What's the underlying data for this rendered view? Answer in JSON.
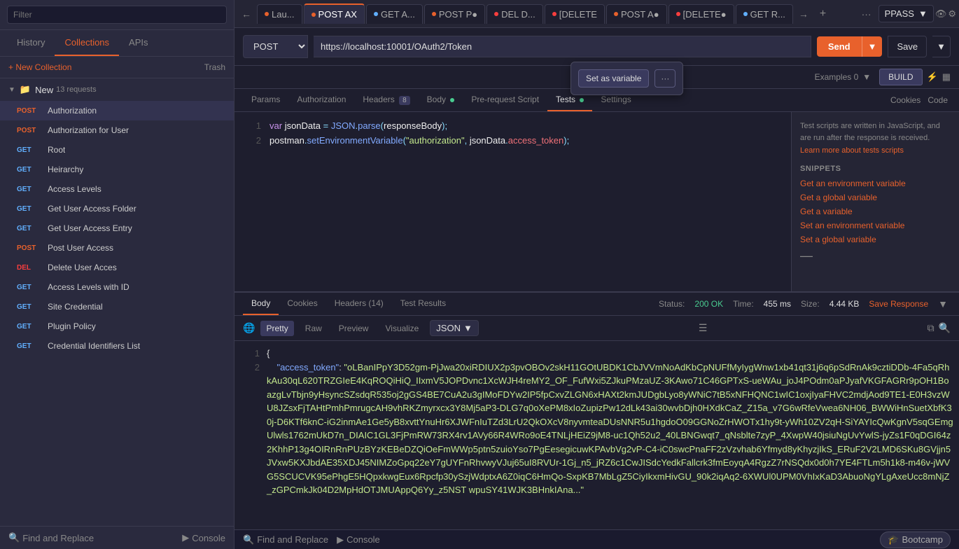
{
  "sidebar": {
    "search_placeholder": "Filter",
    "tabs": [
      "History",
      "Collections",
      "APIs"
    ],
    "active_tab": "Collections",
    "new_collection_label": "+ New Collection",
    "trash_label": "Trash",
    "collection": {
      "name": "New",
      "count": "13 requests"
    },
    "items": [
      {
        "method": "POST",
        "label": "Authorization",
        "active": true
      },
      {
        "method": "POST",
        "label": "Authorization for User"
      },
      {
        "method": "GET",
        "label": "Root"
      },
      {
        "method": "GET",
        "label": "Heirarchy"
      },
      {
        "method": "GET",
        "label": "Access Levels"
      },
      {
        "method": "GET",
        "label": "Get User Access Folder"
      },
      {
        "method": "GET",
        "label": "Get User Access Entry"
      },
      {
        "method": "POST",
        "label": "Post User Access"
      },
      {
        "method": "DEL",
        "label": "Delete User Acces"
      },
      {
        "method": "GET",
        "label": "Access Levels with ID"
      },
      {
        "method": "GET",
        "label": "Site Credential"
      },
      {
        "method": "GET",
        "label": "Plugin Policy"
      },
      {
        "method": "GET",
        "label": "Credential Identifiers List"
      }
    ],
    "bottom": {
      "find_replace": "Find and Replace",
      "console": "Console"
    }
  },
  "tabs_bar": {
    "tabs": [
      {
        "label": "Lau...",
        "method": "POST",
        "dot_color": "orange"
      },
      {
        "label": "POST AX",
        "method": "POST",
        "dot_color": "orange",
        "active": true
      },
      {
        "label": "GET A...",
        "method": "GET",
        "dot_color": "blue"
      },
      {
        "label": "POST P●",
        "method": "POST",
        "dot_color": "orange"
      },
      {
        "label": "DEL D...",
        "method": "DEL",
        "dot_color": "red"
      },
      {
        "label": "[DELETE",
        "method": "DEL",
        "dot_color": "red"
      },
      {
        "label": "POST A●",
        "method": "POST",
        "dot_color": "orange"
      },
      {
        "label": "[DELETE●",
        "method": "DEL",
        "dot_color": "red"
      },
      {
        "label": "GET R...",
        "method": "GET",
        "dot_color": "blue"
      }
    ]
  },
  "env_bar": {
    "environment": "PPASS"
  },
  "request": {
    "method": "POST",
    "url": "https://localhost:10001/OAuth2/Token",
    "send_label": "Send",
    "save_label": "Save"
  },
  "variable_popup": {
    "button_label": "Set as variable",
    "more_label": "···"
  },
  "request_tabs": {
    "tabs": [
      "Params",
      "Authorization",
      "Headers (8)",
      "Body ●",
      "Pre-request Script",
      "Tests ●",
      "Settings"
    ],
    "active": "Tests ●",
    "cookies_label": "Cookies",
    "code_label": "Code"
  },
  "editor": {
    "lines": [
      {
        "num": 1,
        "code": "var jsonData = JSON.parse(responseBody);"
      },
      {
        "num": 2,
        "code": "postman.setEnvironmentVariable(\"authorization\", jsonData.access_token);"
      }
    ]
  },
  "right_panel": {
    "description": "Test scripts are written in JavaScript, and are run after the response is received.",
    "learn_more": "Learn more about tests scripts",
    "snippets_title": "SNIPPETS",
    "snippets": [
      "Get an environment variable",
      "Get a global variable",
      "Get a variable",
      "Set an environment variable",
      "Set a global variable"
    ]
  },
  "response": {
    "tabs": [
      "Body",
      "Cookies",
      "Headers (14)",
      "Test Results"
    ],
    "active_tab": "Body",
    "status": "200 OK",
    "time": "455 ms",
    "size": "4.44 KB",
    "save_response": "Save Response",
    "format_buttons": [
      "Pretty",
      "Raw",
      "Preview",
      "Visualize"
    ],
    "active_format": "Pretty",
    "format_type": "JSON",
    "body_lines": [
      {
        "num": 1,
        "content": "{"
      },
      {
        "num": 2,
        "content": "    \"access_token\": \"oLBanIPpY3D52gm-PjJwa20xiRDIUX2p3pvOBOv2skH11GOtUBDK1CbJVVmNoAdKbCpNUFfMyIygWnw1xb41qt31j6q6pSdRnAk9cztiDDb-4Fa5qRhkAu30qL620TRZGIeE4KqROQiHiQ_IIxmV5JOPDvnc1XcWJH4reMY2_OF_FufWxi5ZJkuPMzaUZ-3KAwo71C46GPTxS-ueWAu_joJ4POdm0aPJyafVKGFAGRr9pOH1BoazgLvTbjn9yHsyncSZsdqR535oj2gGS4BE7CuA2u3gIMoFDYw2IP5fpCxvZLGN6xHAXt2kmJUDgbLyo8yWNiC7tB5xNFHQNC1wIC1oxjIyaFHVC2mdjAod9TE1-E0H3vzWU8JZsxFjTAHtPmhPmrugcAH9vhRKZmyrxcx3Y8Mj5aP3-DLG7q0oXePM8xIoZupizPw12dLk43ai30wvbDjh0HXdkCaZ_Z15a_v7G6wRfeVwea6NH06_BWWiHnSuetXbfK30j-D6KTf6knC-iG2inmAe1Ge5yB8xvttYnuHr6XJWFnIuTZd3LrU2QkOXcV8nyvmteaDUsNNR5u1hgdoO09GGNoZrHWOTx1hy9t-yWh10ZV2qH-SiYAYIcQwKgnV5sqGEmgUlwls1762mUkD7n_DIAIC1GL3FjPmRW73RX4rv1AVy66R4WRo9oE4TNLjHEiZ9jM8-uc1Qh52u2_40LBNGwqt7_qNsblte7zyP_4XwpW40jsiuNgUvYwlS-jyZs1F0qDGI64z2KhhP13g4OIRnRnPUzBYzKEBeDZQiOeFmWWp5ptn5zuioYso7PgEesegicuwKPAvbVg2vP-C4-iC0swcPnaFF2zVzvhab6Yfmyd8yKhyzjIkS_ERuF2V2LMD6SKu8GVjjn5JVxw5KXJbdAE35XDJ45NIMZoGpq22eY7gUYFnRhvwyVJuj65uI8RVUr-1Gj_n5_jRZ6c1CwJISdcYedkFallcrk3fmEoyqA4RgzZ7rNSQdx0d0h7YE4FTLm5h1k8-m46v-jWVG5SCUCVK95ePhgE5HQpxkwgEux6Rpcfp30ySzjWdptxA6Z0iqC6HmQo-SxpKB7MbLgZ5CiyIkxmHivGU_90k2iqAq2-6XWUl0UPM0VhIxKaD3AbuoNgYLgAxeUcc8mNjZ_zGPCmkJk04D2MpHdOTJMUAppQ6Yy_z5NST wpuSY41WJK3BHnkIAna..."
      }
    ]
  },
  "status_bar": {
    "find_replace": "Find and Replace",
    "console": "Console",
    "bootcamp": "Bootcamp"
  }
}
